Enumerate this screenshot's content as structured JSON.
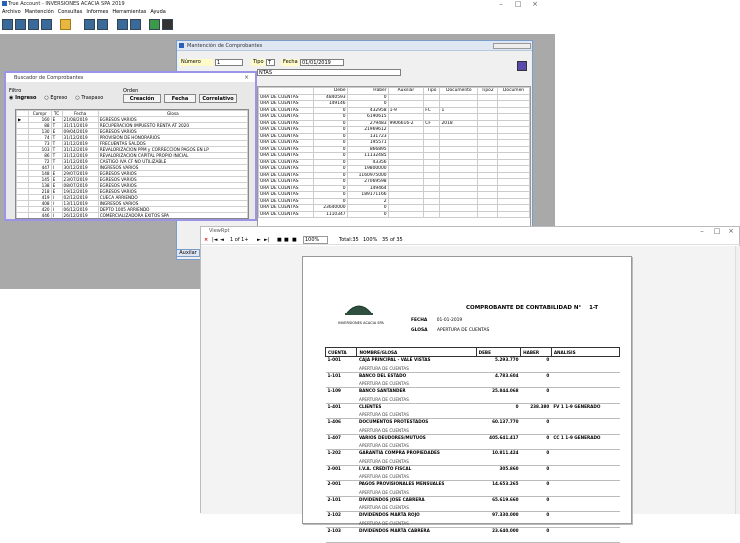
{
  "app": {
    "title": "True Account - INVERSIONES ACACIA SPA 2019"
  },
  "menu": [
    "Archivo",
    "Mantención",
    "Consultas",
    "Informes",
    "Herramientas",
    "Ayuda"
  ],
  "comp_window": {
    "title": "Mantención de Comprobantes",
    "numero_label": "Número",
    "numero_value": "1",
    "tipo_label": "Tipo",
    "tipo_value": "T",
    "fecha_label": "Fecha",
    "fecha_value": "01/01/2019",
    "glosa_value": "NTAS",
    "headers": [
      "",
      "Debe",
      "Haber",
      "Auxiliar",
      "Tipo",
      "Documento",
      "Tipo2",
      "Documen"
    ],
    "rows": [
      [
        "URA DE CUENTAS",
        "4840593",
        "0",
        "",
        "",
        "",
        "",
        ""
      ],
      [
        "URA DE CUENTAS",
        "149146",
        "0",
        "",
        "",
        "",
        "",
        ""
      ],
      [
        "URA DE CUENTAS",
        "0",
        "432958",
        "1-9",
        "FC",
        "1",
        "",
        ""
      ],
      [
        "URA DE CUENTAS",
        "0",
        "6190615",
        "",
        "",
        "",
        "",
        ""
      ],
      [
        "URA DE CUENTAS",
        "0",
        "279483",
        "9906616-2",
        "CF",
        "2018",
        "",
        ""
      ],
      [
        "URA DE CUENTAS",
        "0",
        "21969612",
        "",
        "",
        "",
        "",
        ""
      ],
      [
        "URA DE CUENTAS",
        "0",
        "131723",
        "",
        "",
        "",
        "",
        ""
      ],
      [
        "URA DE CUENTAS",
        "0",
        "195571",
        "",
        "",
        "",
        "",
        ""
      ],
      [
        "URA DE CUENTAS",
        "0",
        "866895",
        "",
        "",
        "",
        "",
        ""
      ],
      [
        "URA DE CUENTAS",
        "0",
        "11132485",
        "",
        "",
        "",
        "",
        ""
      ],
      [
        "URA DE CUENTAS",
        "0",
        "43356",
        "",
        "",
        "",
        "",
        ""
      ],
      [
        "URA DE CUENTAS",
        "0",
        "19800000",
        "",
        "",
        "",
        "",
        ""
      ],
      [
        "URA DE CUENTAS",
        "0",
        "1160975000",
        "",
        "",
        "",
        "",
        ""
      ],
      [
        "URA DE CUENTAS",
        "0",
        "27069598",
        "",
        "",
        "",
        "",
        ""
      ],
      [
        "URA DE CUENTAS",
        "0",
        "149464",
        "",
        "",
        "",
        "",
        ""
      ],
      [
        "URA DE CUENTAS",
        "0",
        "189171166",
        "",
        "",
        "",
        "",
        ""
      ],
      [
        "URA DE CUENTAS",
        "0",
        "2",
        "",
        "",
        "",
        "",
        ""
      ],
      [
        "URA DE CUENTAS",
        "23640000",
        "0",
        "",
        "",
        "",
        "",
        ""
      ],
      [
        "URA DE CUENTAS",
        "1110347",
        "0",
        "",
        "",
        "",
        "",
        ""
      ]
    ],
    "auxiliar_button": "Auxilar"
  },
  "search_window": {
    "title": "Buscador de Comprobantes",
    "filtro_label": "Filtro",
    "orden_label": "Orden",
    "radios": [
      "Ingreso",
      "Egreso",
      "Traspaso"
    ],
    "order_buttons": [
      "Creación",
      "Fecha",
      "Correlativo"
    ],
    "headers": [
      "",
      "Compr",
      "TC",
      "Fecha",
      "Glosa"
    ],
    "rows": [
      [
        "160",
        "E",
        "21/08/2019",
        "EGRESOS VARIOS"
      ],
      [
        "88",
        "T",
        "31/11/2019",
        "RECUPERACION IMPUESTO RENTA AT 2020"
      ],
      [
        "130",
        "E",
        "09/04/2019",
        "EGRESOS VARIOS"
      ],
      [
        "74",
        "T",
        "31/12/2019",
        "PROVISION DE HONORARIOS"
      ],
      [
        "73",
        "T",
        "31/12/2019",
        "FRECUENTAS SALDOS"
      ],
      [
        "103",
        "T",
        "31/12/2019",
        "REVALORIZACION PPM y CORRECCION PAGOS EN LP"
      ],
      [
        "86",
        "T",
        "31/12/2019",
        "REVALORIZACION CAPITAL PROPIO INICIAL"
      ],
      [
        "72",
        "T",
        "31/12/2019",
        "CASTIGO IVA CF NO UTILIZABLE"
      ],
      [
        "447",
        "I",
        "30/12/2019",
        "INGRESOS VARIOS"
      ],
      [
        "148",
        "E",
        "29/07/2019",
        "EGRESOS VARIOS"
      ],
      [
        "145",
        "E",
        "23/07/2019",
        "EGRESOS VARIOS"
      ],
      [
        "138",
        "E",
        "08/07/2019",
        "EGRESOS VARIOS"
      ],
      [
        "218",
        "E",
        "19/12/2019",
        "EGRESOS VARIOS"
      ],
      [
        "419",
        "I",
        "02/12/2019",
        "CUECA ARRIENDO"
      ],
      [
        "408",
        "I",
        "13/11/2019",
        "INGRESOS VARIOS"
      ],
      [
        "420",
        "I",
        "06/12/2019",
        "DEPTO 1005 ARRIENDO"
      ],
      [
        "446",
        "I",
        "26/12/2019",
        "COMERCIALIZADORA EXITOS SPA"
      ],
      [
        "441",
        "I",
        "23/12/2019",
        "INGRESOS VARIOS"
      ],
      [
        "414",
        "I",
        "02/12/2019",
        "INGRESOS VARIOS"
      ]
    ]
  },
  "viewer": {
    "title": "ViewRpt",
    "page": "1 of 1+",
    "zoom": "100%",
    "total": "Total:35",
    "pct": "100%",
    "count": "35 of 35"
  },
  "report": {
    "logo_caption": "INVERSIONES ACACIA SPA",
    "title_label": "COMPROBANTE DE CONTABILIDAD N°",
    "title_number": "1-T",
    "fecha_label": "FECHA",
    "fecha_value": "01-01-2019",
    "glosa_label": "GLOSA",
    "glosa_value": "APERTURA DE CUENTAS",
    "headers": [
      "CUENTA",
      "NOMBRE/GLOSA",
      "DEBE",
      "HABER",
      "ANALISIS"
    ],
    "rows": [
      {
        "cuenta": "1-001",
        "nombre": "CAJA PRINCIPAL - VALE VISTAS",
        "glosa": "APERTURA DE CUENTAS",
        "debe": "5.293.770",
        "haber": "0",
        "analisis": ""
      },
      {
        "cuenta": "1-101",
        "nombre": "BANCO DEL ESTADO",
        "glosa": "APERTURA DE CUENTAS",
        "debe": "4.783.604",
        "haber": "0",
        "analisis": ""
      },
      {
        "cuenta": "1-109",
        "nombre": "BANCO SANTANDER",
        "glosa": "APERTURA DE CUENTAS",
        "debe": "25.844.068",
        "haber": "0",
        "analisis": ""
      },
      {
        "cuenta": "1-401",
        "nombre": "CLIENTES",
        "glosa": "APERTURA DE CUENTAS",
        "debe": "0",
        "haber": "238.380",
        "analisis": "FV 1 1-9 GENERADO"
      },
      {
        "cuenta": "1-406",
        "nombre": "DOCUMENTOS PROTESTADOS",
        "glosa": "APERTURA DE CUENTAS",
        "debe": "60.137.770",
        "haber": "0",
        "analisis": ""
      },
      {
        "cuenta": "1-407",
        "nombre": "VARIOS DEUDORES/MUTUOS",
        "glosa": "APERTURA DE CUENTAS",
        "debe": "405.641.417",
        "haber": "0",
        "analisis": "CC 1 1-9 GENERADO"
      },
      {
        "cuenta": "1-202",
        "nombre": "GARANTIA COMPRA PROPIEDADES",
        "glosa": "APERTURA DE CUENTAS",
        "debe": "10.811.424",
        "haber": "0",
        "analisis": ""
      },
      {
        "cuenta": "2-001",
        "nombre": "I.V.A. CREDITO FISCAL",
        "glosa": "APERTURA DE CUENTAS",
        "debe": "305.860",
        "haber": "0",
        "analisis": ""
      },
      {
        "cuenta": "2-001",
        "nombre": "PAGOS PROVISIONALES MENSUALES",
        "glosa": "APERTURA DE CUENTAS",
        "debe": "14.653.265",
        "haber": "0",
        "analisis": ""
      },
      {
        "cuenta": "2-101",
        "nombre": "DIVIDENDOS JOSE CABRERA",
        "glosa": "APERTURA DE CUENTAS",
        "debe": "65.619.660",
        "haber": "0",
        "analisis": ""
      },
      {
        "cuenta": "2-102",
        "nombre": "DIVIDENDOS MARTA ROJO",
        "glosa": "APERTURA DE CUENTAS",
        "debe": "97.330.000",
        "haber": "0",
        "analisis": ""
      },
      {
        "cuenta": "2-103",
        "nombre": "DIVIDENDOS MARTA CABRERA",
        "glosa": "",
        "debe": "23.640.000",
        "haber": "0",
        "analisis": ""
      }
    ]
  }
}
